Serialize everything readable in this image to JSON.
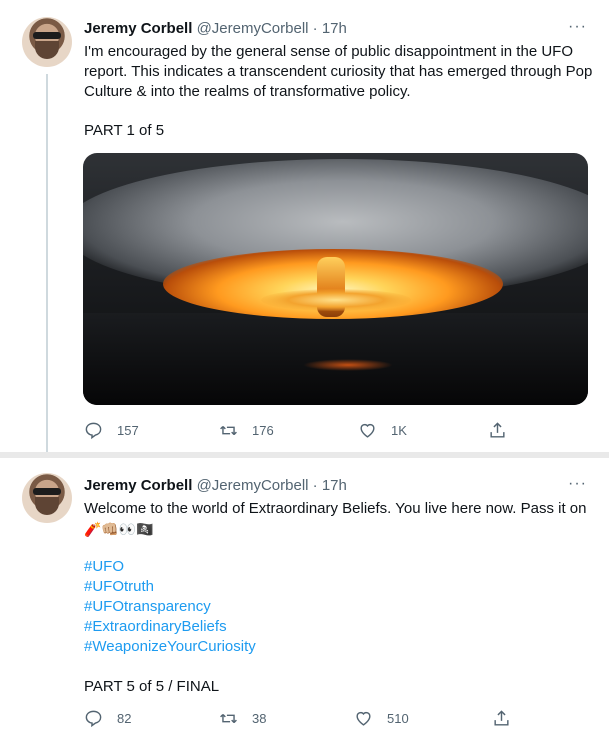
{
  "tweets": [
    {
      "author_name": "Jeremy Corbell",
      "author_handle": "@JeremyCorbell",
      "time": "17h",
      "more": "···",
      "text_lines": [
        "I'm encouraged by the general sense of public disappointment in the UFO",
        "report. This indicates a transcendent curiosity that has emerged through Pop",
        "Culture & into the realms of transformative policy."
      ],
      "part": "PART 1 of 5",
      "replies": "157",
      "retweets": "176",
      "likes": "1K"
    },
    {
      "author_name": "Jeremy Corbell",
      "author_handle": "@JeremyCorbell",
      "time": "17h",
      "more": "···",
      "text": "Welcome to the world of Extraordinary Beliefs. You live here now. Pass it on",
      "emoji": "🧨👊🏼👀🏴‍☠️",
      "hashtags": [
        "#UFO",
        "#UFOtruth",
        "#UFOtransparency",
        "#ExtraordinaryBeliefs",
        "#WeaponizeYourCuriosity"
      ],
      "part": "PART 5 of 5 / FINAL",
      "replies": "82",
      "retweets": "38",
      "likes": "510"
    }
  ],
  "colors": {
    "link": "#1d9bf0",
    "secondary_text": "#536471",
    "thread_line": "#cfd9de"
  },
  "icons": [
    "more-icon",
    "reply-icon",
    "retweet-icon",
    "like-icon",
    "share-icon"
  ]
}
